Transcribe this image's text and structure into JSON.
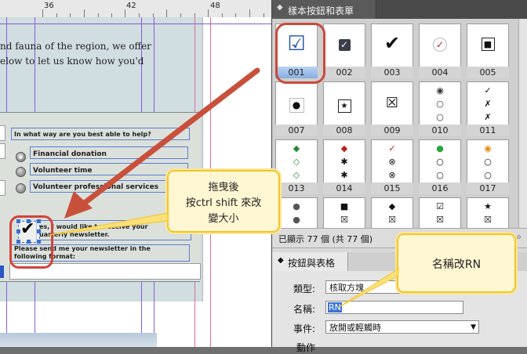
{
  "ruler": {
    "labels": [
      "36",
      "42",
      "48"
    ]
  },
  "document": {
    "intro_lines": [
      "nd fauna of the region, we offer",
      "elow to let us know how you'd"
    ],
    "question": "In what way are you best able to help?",
    "options": [
      "Financial donation",
      "Volunteer time",
      "Volunteer professional services"
    ],
    "newsletter_lines": [
      "es, I would like to receive your",
      "uarterly newsletter."
    ],
    "format_lines": [
      "Please send me your newsletter in the",
      "following format:"
    ]
  },
  "callout_left": {
    "lines": [
      "拖曳後",
      "按ctrl shift 來改",
      "變大小"
    ]
  },
  "panel": {
    "title": "樣本按鈕和表單",
    "cells": [
      {
        "label": "001",
        "icon": "checkbox-checked-icon",
        "glyph": "☑"
      },
      {
        "label": "002",
        "icon": "checkbox-dark-check-icon",
        "glyph": "✓"
      },
      {
        "label": "003",
        "icon": "checkmark-icon",
        "glyph": "✔"
      },
      {
        "label": "004",
        "icon": "red-check-circle-icon",
        "glyph": "✓"
      },
      {
        "label": "005",
        "icon": "square-filled-icon",
        "glyph": "■"
      },
      {
        "label": "007",
        "icon": "dot-filled-icon",
        "glyph": "●"
      },
      {
        "label": "008",
        "icon": "star-box-icon",
        "glyph": "★"
      },
      {
        "label": "009",
        "icon": "x-box-icon",
        "glyph": "☒"
      },
      {
        "label": "010",
        "icon": "radio-stack-icon",
        "glyph": "◉"
      },
      {
        "label": "011",
        "icon": "check-x-stack-icon",
        "glyph": "✓"
      },
      {
        "label": "013",
        "icon": "diamond-stack-icon",
        "glyph": "◆"
      },
      {
        "label": "014",
        "icon": "red-diamond-stack-icon",
        "glyph": "◆"
      },
      {
        "label": "015",
        "icon": "circle-check-stack-icon",
        "glyph": "✓"
      },
      {
        "label": "016",
        "icon": "green-dot-stack-icon",
        "glyph": "●"
      },
      {
        "label": "017",
        "icon": "orange-dot-stack-icon",
        "glyph": "◉"
      }
    ],
    "status": "已顯示 77 個 (共 77 個)",
    "section2_title": "按鈕與表格",
    "type_label": "類型:",
    "type_value": "核取方塊",
    "name_label": "名稱:",
    "name_value": "RN",
    "event_label": "事件:",
    "event_value": "放開或輕觸時",
    "action_label": "動作"
  },
  "callout_right": {
    "text": "名稱改RN"
  },
  "colors": {
    "arrow": "#c8503a",
    "callout_border": "#f2c52c",
    "selection": "#3a73d1"
  }
}
